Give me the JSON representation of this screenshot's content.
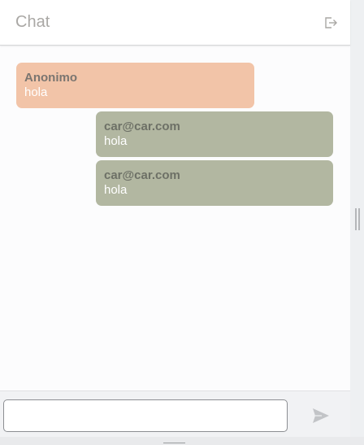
{
  "header": {
    "title": "Chat",
    "logout_icon": "logout-icon"
  },
  "messages": [
    {
      "sender": "Anonimo",
      "text": "hola",
      "side": "left"
    },
    {
      "sender": "car@car.com",
      "text": "hola",
      "side": "right"
    },
    {
      "sender": "car@car.com",
      "text": "hola",
      "side": "right"
    }
  ],
  "composer": {
    "value": "",
    "placeholder": "",
    "send_icon": "send-icon"
  },
  "colors": {
    "peer_bubble": "#f2c4a8",
    "own_bubble": "#b2b7a1",
    "title": "#aaa8a5"
  }
}
